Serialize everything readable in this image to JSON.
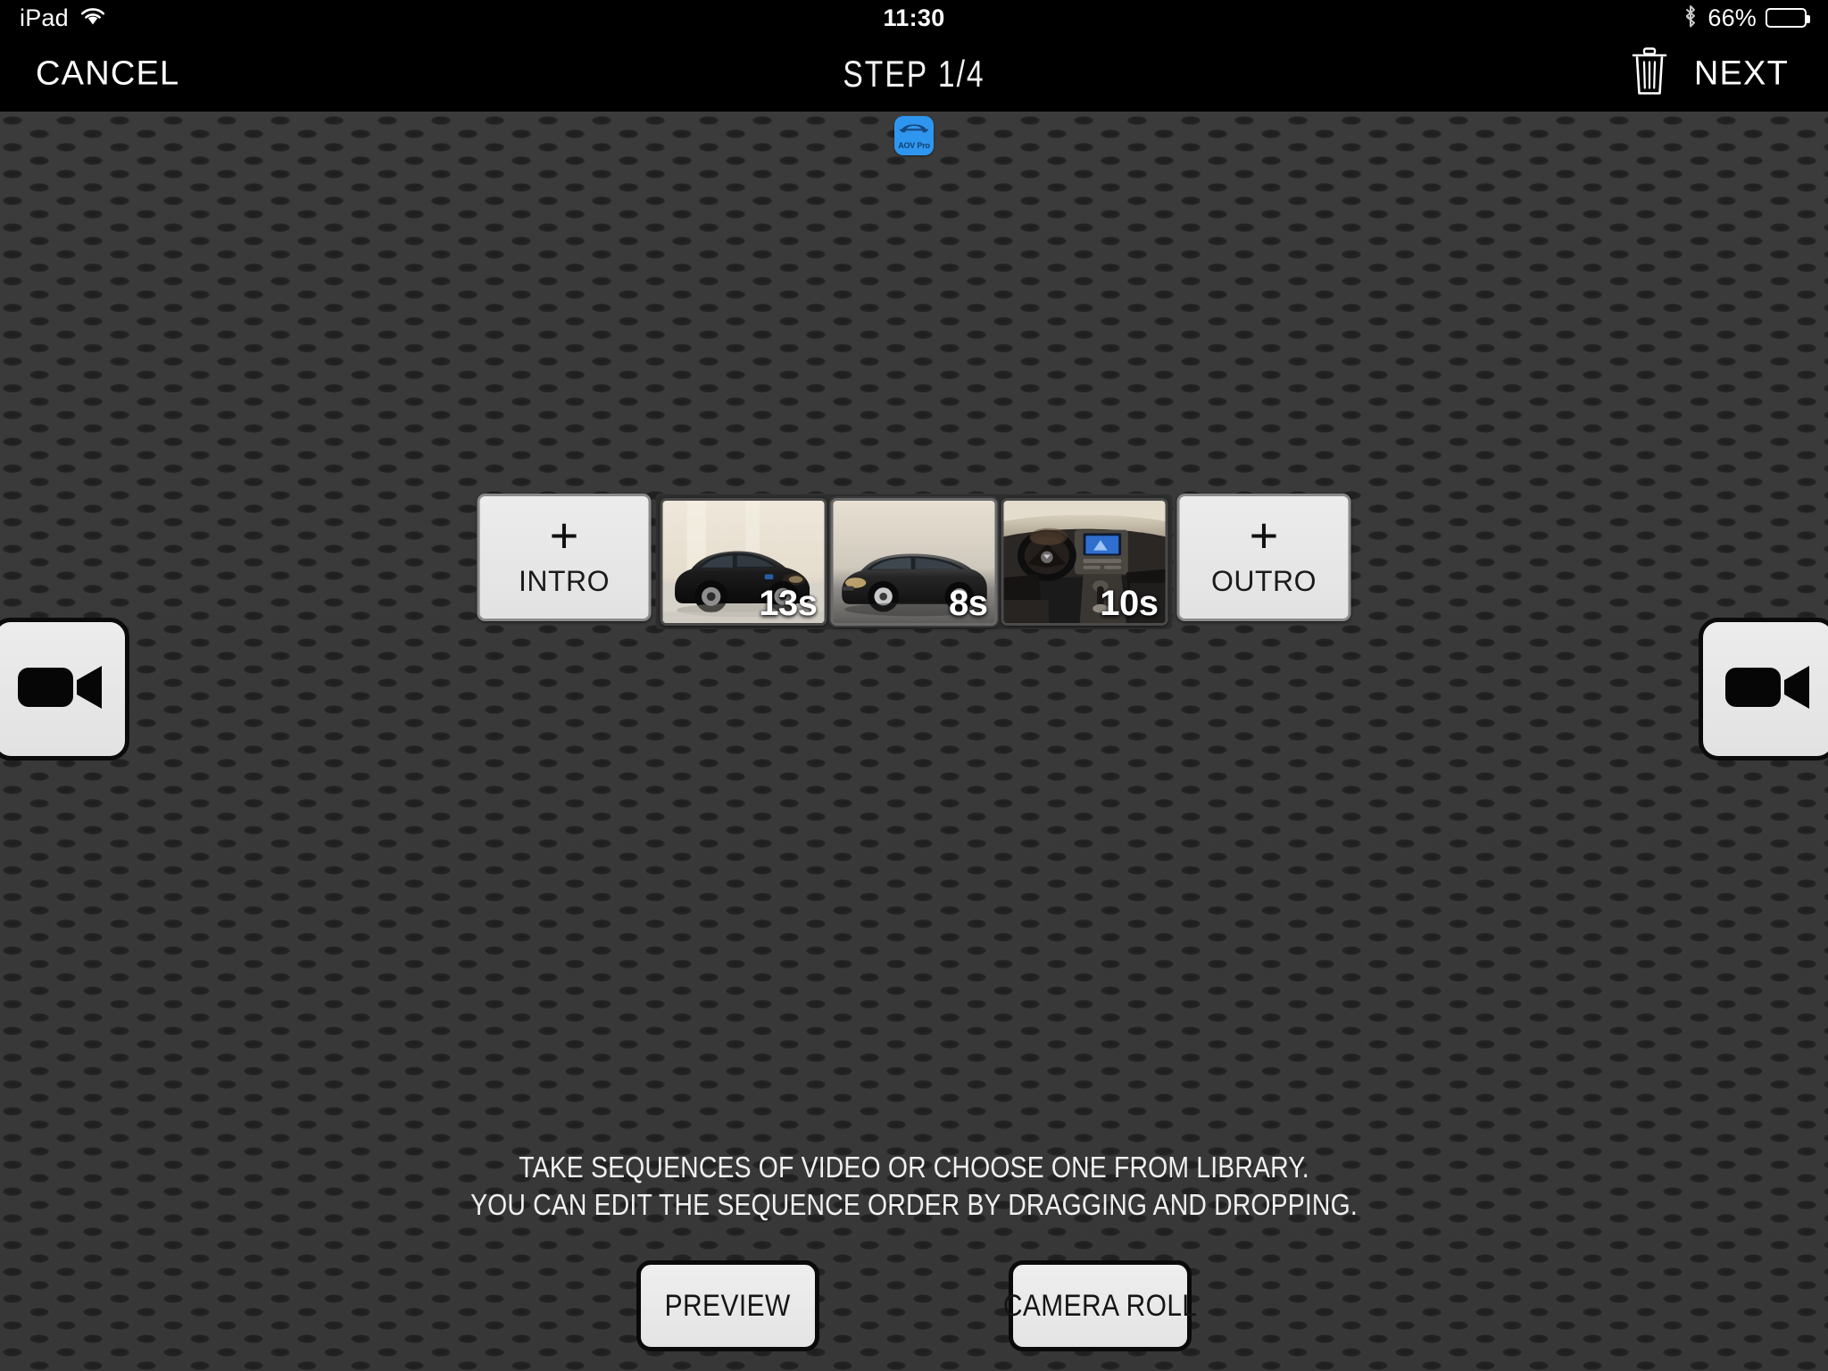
{
  "status_bar": {
    "device": "iPad",
    "wifi_icon": "wifi-icon",
    "time": "11:30",
    "bluetooth_icon": "bluetooth-icon",
    "battery_percent": "66%",
    "battery_level": 66
  },
  "nav_bar": {
    "cancel_label": "CANCEL",
    "title": "STEP 1/4",
    "trash_icon": "trash-icon",
    "next_label": "NEXT"
  },
  "app_badge": {
    "name": "AOV Pro",
    "icon": "car-front-icon",
    "color": "#2f96f0"
  },
  "filmstrip": {
    "intro": {
      "label": "INTRO",
      "plus": "+"
    },
    "outro": {
      "label": "OUTRO",
      "plus": "+"
    },
    "clips": [
      {
        "duration": "13s",
        "scene": "black-sedan-front-three-quarter",
        "selected": false
      },
      {
        "duration": "8s",
        "scene": "dark-sedan-side-profile",
        "selected": true
      },
      {
        "duration": "10s",
        "scene": "car-interior-dashboard",
        "selected": false
      }
    ]
  },
  "camera_buttons": {
    "left_icon": "video-camera-icon",
    "right_icon": "video-camera-icon"
  },
  "help": {
    "line1": "TAKE SEQUENCES OF VIDEO OR CHOOSE ONE FROM LIBRARY.",
    "line2": "YOU CAN EDIT THE SEQUENCE ORDER BY DRAGGING AND DROPPING."
  },
  "bottom": {
    "preview_label": "PREVIEW",
    "camera_roll_label": "CAMERA ROLL"
  },
  "colors": {
    "background": "#3a3a3a",
    "nav_background": "#000000",
    "button_face": "#e9e9e9",
    "accent_blue": "#2f96f0"
  }
}
